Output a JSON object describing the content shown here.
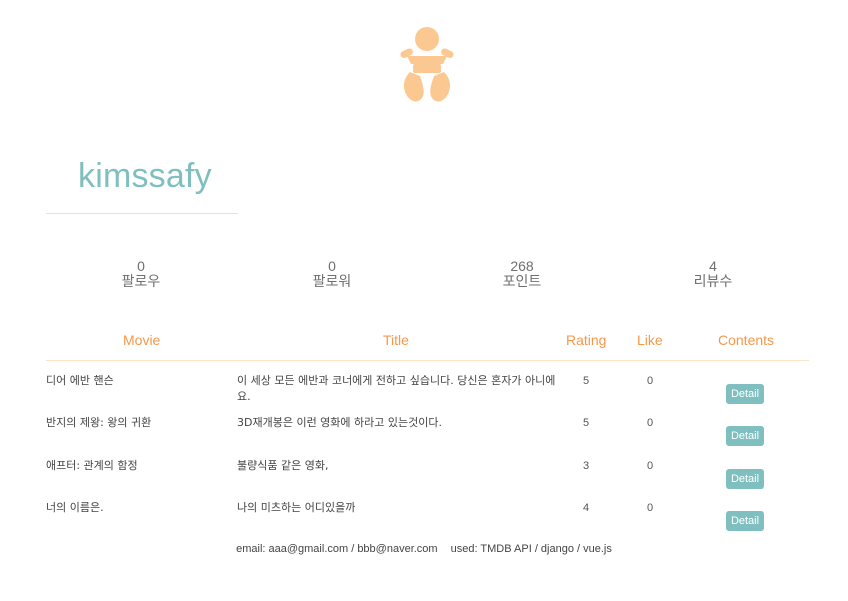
{
  "profile": {
    "username": "kimssafy",
    "avatar_icon": "baby-icon",
    "accent_color": "#fcc891"
  },
  "stats": [
    {
      "value": "0",
      "label": "팔로우"
    },
    {
      "value": "0",
      "label": "팔로워"
    },
    {
      "value": "268",
      "label": "포인트"
    },
    {
      "value": "4",
      "label": "리뷰수"
    }
  ],
  "table": {
    "headers": {
      "movie": "Movie",
      "title": "Title",
      "rating": "Rating",
      "like": "Like",
      "contents": "Contents"
    },
    "rows": [
      {
        "movie": "디어 에반 핸슨",
        "title": "이 세상 모든 에반과 코너에게 전하고 싶습니다. 당신은 혼자가 아니에요.",
        "rating": "5",
        "like": "0",
        "button": "Detail"
      },
      {
        "movie": "반지의 제왕: 왕의 귀환",
        "title": "3D재개봉은 이런 영화에 하라고 있는것이다.",
        "rating": "5",
        "like": "0",
        "button": "Detail"
      },
      {
        "movie": "애프터: 관계의 함정",
        "title": "불량식품 같은 영화,",
        "rating": "3",
        "like": "0",
        "button": "Detail"
      },
      {
        "movie": "너의 이름은.",
        "title": "나의 미츠하는 어디있을까",
        "rating": "4",
        "like": "0",
        "button": "Detail"
      }
    ]
  },
  "footer": {
    "email": "email: aaa@gmail.com / bbb@naver.com",
    "used": "used: TMDB API / django / vue.js"
  },
  "colors": {
    "username": "#7fbfbf",
    "header": "#f6984a",
    "button": "#7fbfbf"
  }
}
